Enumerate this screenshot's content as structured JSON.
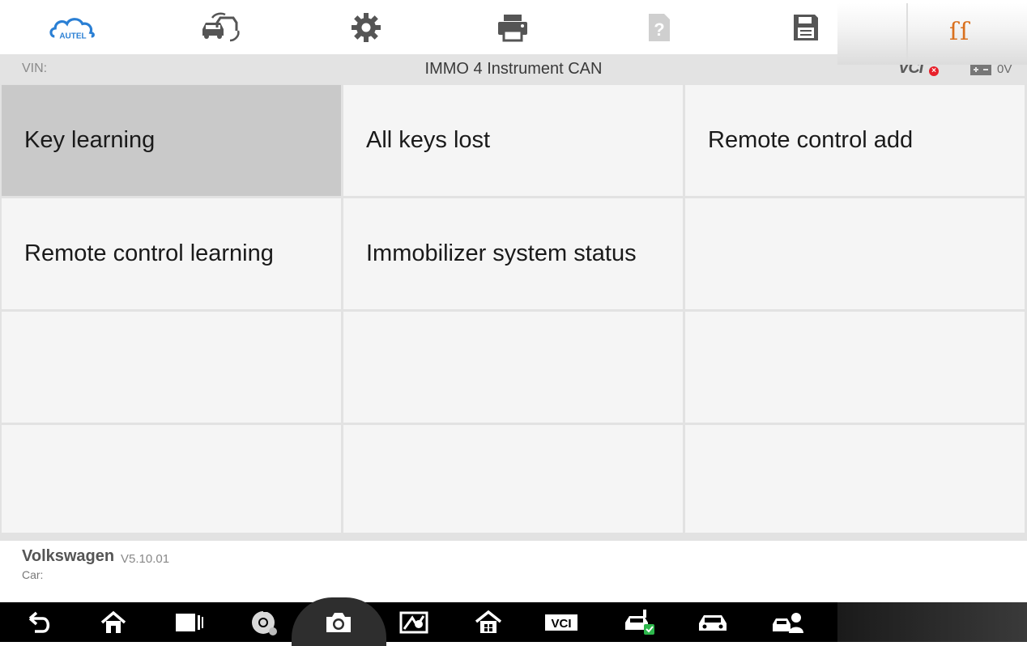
{
  "toolbar": {
    "items": [
      {
        "icon": "autel-cloud-logo-icon",
        "label": "AUTEL"
      },
      {
        "icon": "vehicle-swap-icon"
      },
      {
        "icon": "gear-icon"
      },
      {
        "icon": "printer-icon"
      },
      {
        "icon": "help-icon"
      },
      {
        "icon": "save-icon"
      },
      {
        "icon": "feedback-chat-icon"
      }
    ],
    "brand_color": "#2a7fd4"
  },
  "status": {
    "vin_label": "VIN:",
    "title": "IMMO 4 Instrument CAN",
    "vci_label": "VCI",
    "voltage": "0V",
    "vci_status_color": "#e8202a"
  },
  "functions": [
    {
      "label": "Key learning",
      "selected": true
    },
    {
      "label": "All keys lost",
      "selected": false
    },
    {
      "label": "Remote control add",
      "selected": false
    },
    {
      "label": "Remote control learning",
      "selected": false
    },
    {
      "label": "Immobilizer system status",
      "selected": false
    },
    {
      "label": "",
      "selected": false
    },
    {
      "label": "",
      "selected": false
    },
    {
      "label": "",
      "selected": false
    },
    {
      "label": "",
      "selected": false
    },
    {
      "label": "",
      "selected": false
    },
    {
      "label": "",
      "selected": false
    },
    {
      "label": "",
      "selected": false
    }
  ],
  "footer": {
    "make": "Volkswagen",
    "version": "V5.10.01",
    "car_label": "Car:"
  },
  "navbar": {
    "items": [
      {
        "icon": "back-icon"
      },
      {
        "icon": "home-icon"
      },
      {
        "icon": "recent-apps-icon"
      },
      {
        "icon": "chrome-browser-icon"
      },
      {
        "icon": "camera-icon"
      },
      {
        "icon": "display-brightness-icon"
      },
      {
        "icon": "autel-home-icon"
      },
      {
        "icon": "vci-icon"
      },
      {
        "icon": "car-check-icon"
      },
      {
        "icon": "car-icon"
      },
      {
        "icon": "remote-support-icon"
      }
    ]
  }
}
